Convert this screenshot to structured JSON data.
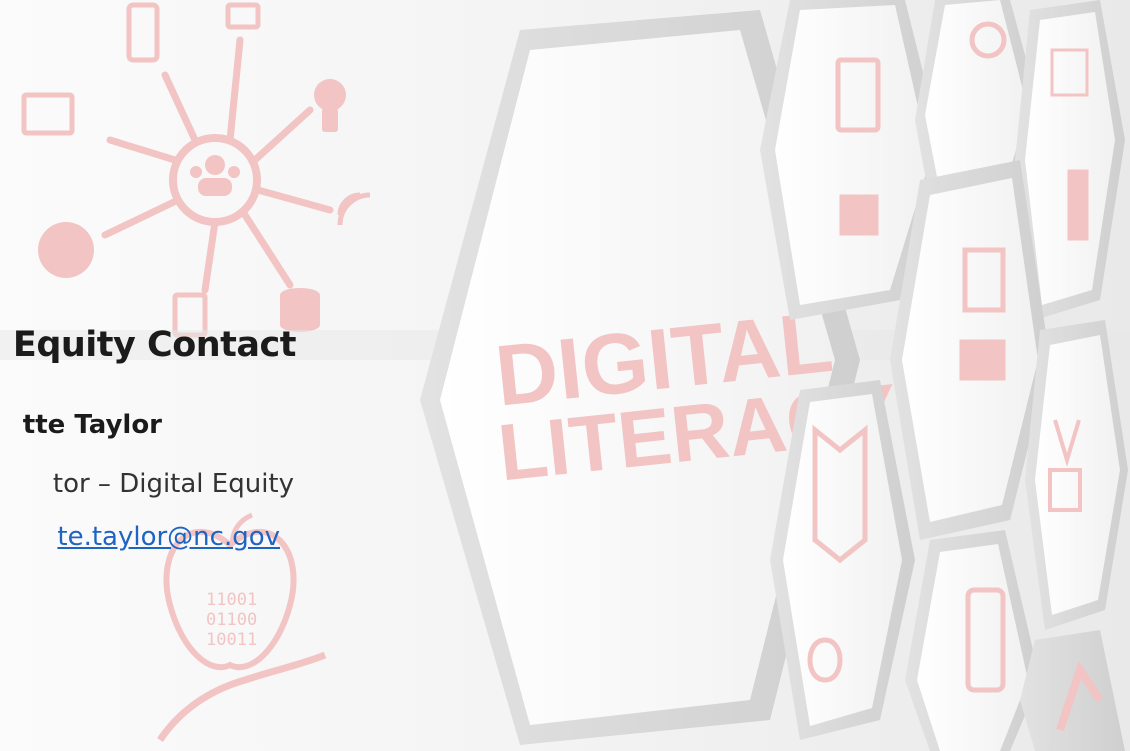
{
  "contact": {
    "title": "Equity Contact",
    "name": "tte Taylor",
    "role": "tor – Digital Equity",
    "email": "te.taylor@nc.gov"
  },
  "background": {
    "headline_line1": "DIGITAL",
    "headline_line2": "LITERACY",
    "binary_lines": [
      "11001",
      "01100",
      "10011"
    ],
    "accent_color": "#f2c4c4",
    "link_color": "#1f64c2"
  }
}
